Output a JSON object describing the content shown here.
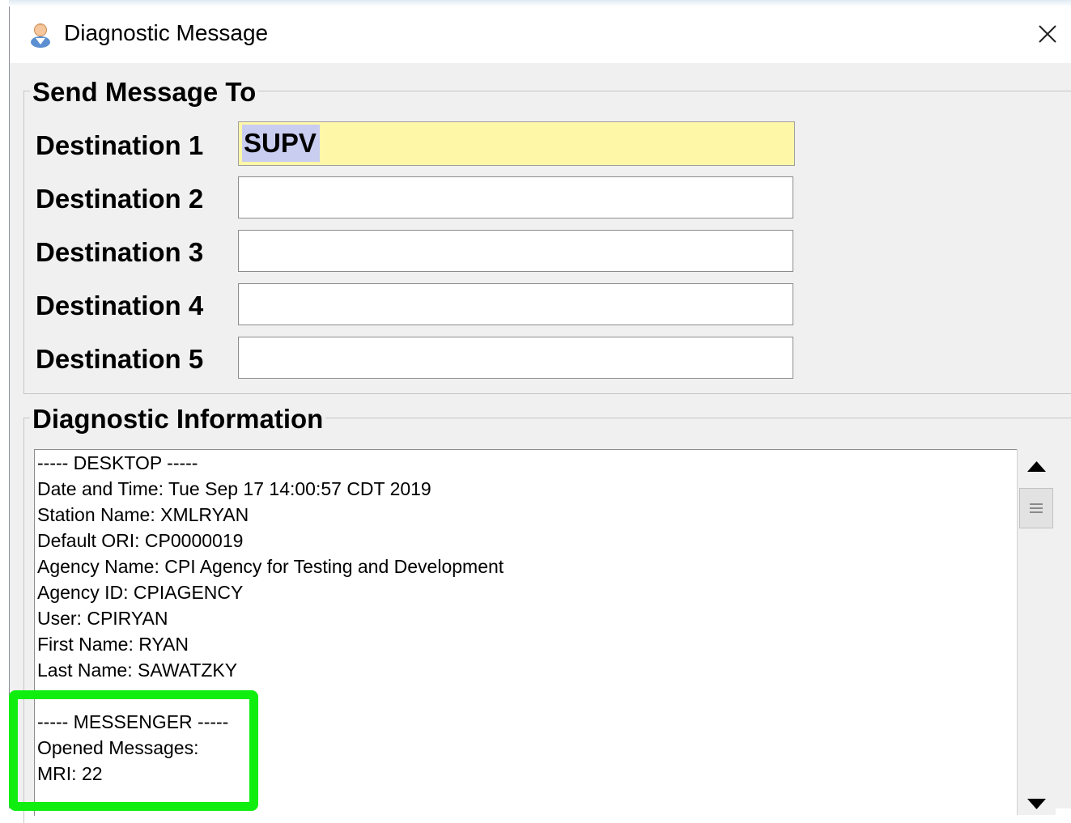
{
  "window": {
    "title": "Diagnostic Message",
    "icon": "user-icon",
    "close_icon": "close-icon"
  },
  "send_group": {
    "title": "Send Message To",
    "destinations": [
      {
        "label": "Destination 1",
        "value": "SUPV"
      },
      {
        "label": "Destination 2",
        "value": ""
      },
      {
        "label": "Destination 3",
        "value": ""
      },
      {
        "label": "Destination 4",
        "value": ""
      },
      {
        "label": "Destination 5",
        "value": ""
      }
    ]
  },
  "diag_group": {
    "title": "Diagnostic Information",
    "lines": [
      "----- DESKTOP -----",
      "Date and Time: Tue Sep 17 14:00:57 CDT 2019",
      "Station Name: XMLRYAN",
      "Default ORI: CP0000019",
      "Agency Name: CPI Agency for Testing and Development",
      "Agency ID: CPIAGENCY",
      "User: CPIRYAN",
      "First Name: RYAN",
      "Last Name: SAWATZKY",
      "",
      "----- MESSENGER -----",
      "Opened Messages:",
      "MRI: 22"
    ]
  },
  "colors": {
    "active_field": "#fff7a8",
    "selection": "#c9cdf0",
    "highlight": "#10ee10",
    "dialog_bg": "#f0f0f0"
  }
}
